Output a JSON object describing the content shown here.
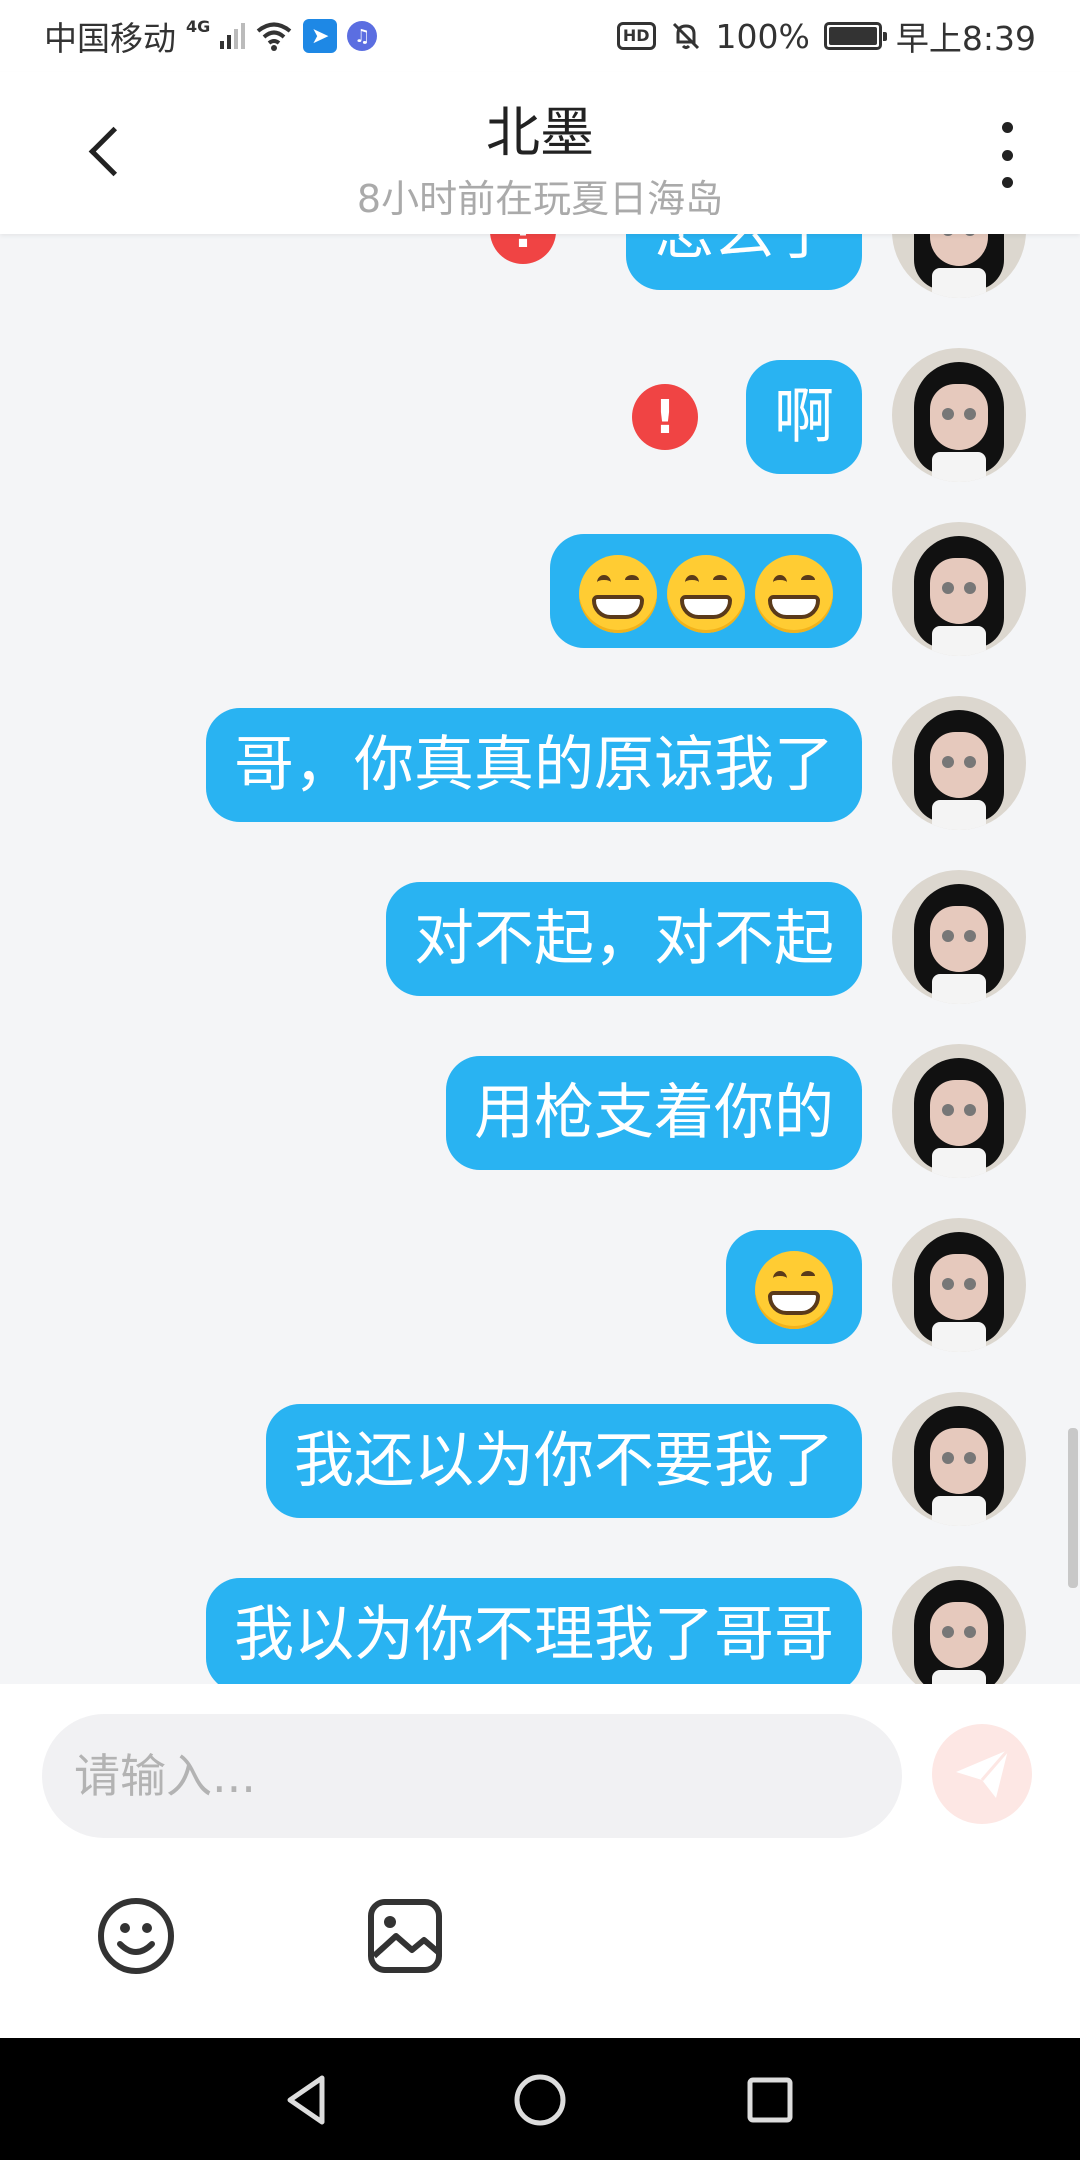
{
  "status_bar": {
    "carrier": "中国移动",
    "network": "4G",
    "battery": "100%",
    "time": "早上8:39",
    "hd_badge": "HD",
    "icons": [
      "signal-icon",
      "wifi-icon",
      "app-notification-icon",
      "music-icon",
      "hd-icon",
      "mute-bell-icon",
      "battery-icon"
    ]
  },
  "header": {
    "title": "北墨",
    "subtitle": "8小时前在玩夏日海岛",
    "back_icon": "chevron-left-icon",
    "more_icon": "more-vertical-icon"
  },
  "messages": [
    {
      "text": "怎么了",
      "sender": "self",
      "failed": true,
      "partial": true
    },
    {
      "text": "啊",
      "sender": "self",
      "failed": true
    },
    {
      "text": "😁😁😁",
      "sender": "self",
      "failed": false,
      "emoji_count": 3
    },
    {
      "text": "哥，你真真的原谅我了",
      "sender": "self",
      "failed": false
    },
    {
      "text": "对不起，对不起",
      "sender": "self",
      "failed": false
    },
    {
      "text": "用枪支着你的",
      "sender": "self",
      "failed": false
    },
    {
      "text": "😁",
      "sender": "self",
      "failed": false,
      "emoji_count": 1
    },
    {
      "text": "我还以为你不要我了",
      "sender": "self",
      "failed": false
    },
    {
      "text": "我以为你不理我了哥哥",
      "sender": "self",
      "failed": false
    }
  ],
  "input": {
    "placeholder": "请输入...",
    "value": "",
    "send_icon": "send-icon",
    "tools": [
      "emoji-icon",
      "image-icon"
    ]
  },
  "colors": {
    "bubble": "#29b3f2",
    "error": "#f04444",
    "chat_bg": "#f4f5f7",
    "send_disabled": "#fde7e4"
  },
  "nav_bar": {
    "icons": [
      "back-triangle-icon",
      "home-circle-icon",
      "recents-square-icon"
    ]
  }
}
